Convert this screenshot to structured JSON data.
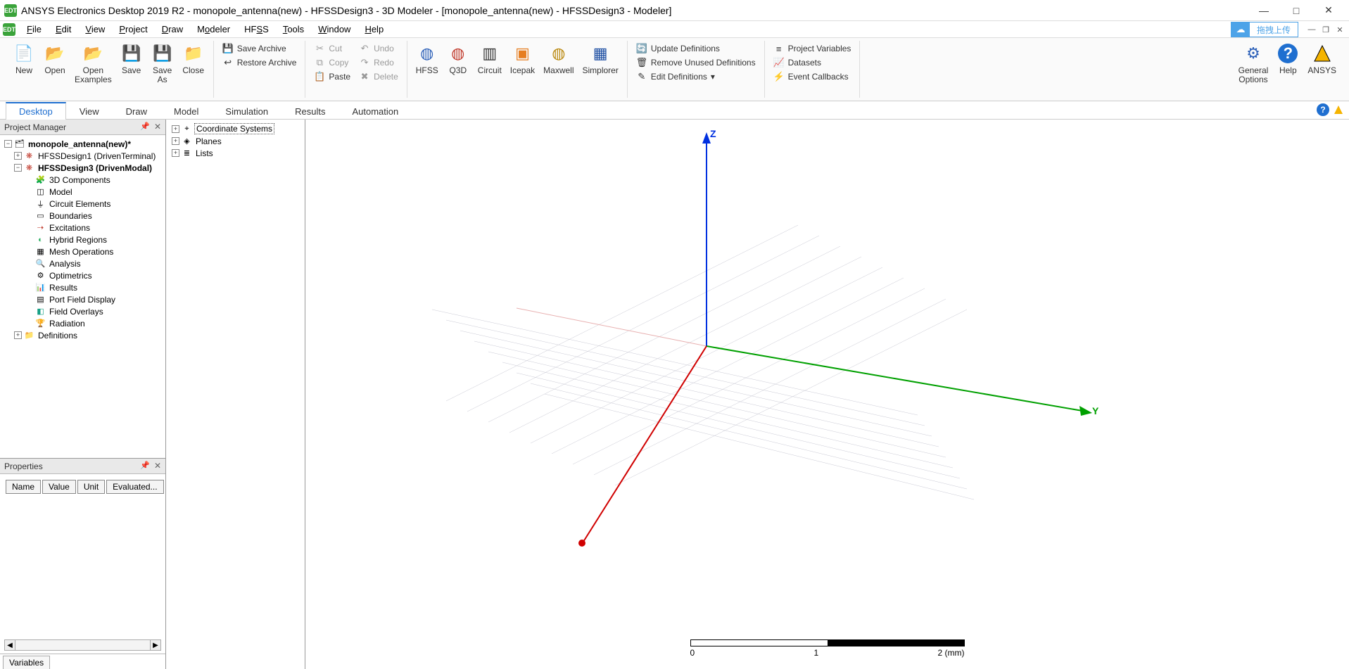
{
  "title": "ANSYS Electronics Desktop 2019 R2 - monopole_antenna(new) - HFSSDesign3 - 3D Modeler - [monopole_antenna(new) - HFSSDesign3 - Modeler]",
  "menus": [
    "File",
    "Edit",
    "View",
    "Project",
    "Draw",
    "Modeler",
    "HFSS",
    "Tools",
    "Window",
    "Help"
  ],
  "upload_label": "拖拽上传",
  "ribbon": {
    "files": {
      "new": "New",
      "open": "Open",
      "open_examples": "Open\nExamples",
      "save": "Save",
      "save_as": "Save\nAs",
      "close": "Close"
    },
    "archive": {
      "save": "Save Archive",
      "restore": "Restore Archive"
    },
    "clip": {
      "cut": "Cut",
      "copy": "Copy",
      "paste": "Paste",
      "undo": "Undo",
      "redo": "Redo",
      "delete": "Delete"
    },
    "sims": {
      "hfss": "HFSS",
      "q3d": "Q3D",
      "circuit": "Circuit",
      "icepak": "Icepak",
      "maxwell": "Maxwell",
      "simplorer": "Simplorer"
    },
    "defs": {
      "update": "Update Definitions",
      "remove": "Remove Unused Definitions",
      "edit": "Edit Definitions"
    },
    "proj": {
      "vars": "Project Variables",
      "datasets": "Datasets",
      "callbacks": "Event Callbacks"
    },
    "right": {
      "general": "General\nOptions",
      "help": "Help",
      "ansys": "ANSYS"
    }
  },
  "tabs": [
    "Desktop",
    "View",
    "Draw",
    "Model",
    "Simulation",
    "Results",
    "Automation"
  ],
  "active_tab": 0,
  "pm_title": "Project Manager",
  "props_title": "Properties",
  "props_cols": [
    "Name",
    "Value",
    "Unit",
    "Evaluated..."
  ],
  "variables_tab": "Variables",
  "project_tree": {
    "root": "monopole_antenna(new)*",
    "designs": [
      {
        "label": "HFSSDesign1 (DrivenTerminal)",
        "bold": false
      },
      {
        "label": "HFSSDesign3 (DrivenModal)",
        "bold": true
      }
    ],
    "children": [
      "3D Components",
      "Model",
      "Circuit Elements",
      "Boundaries",
      "Excitations",
      "Hybrid Regions",
      "Mesh Operations",
      "Analysis",
      "Optimetrics",
      "Results",
      "Port Field Display",
      "Field Overlays",
      "Radiation"
    ],
    "defs": "Definitions"
  },
  "modeler_tree": [
    "Coordinate Systems",
    "Planes",
    "Lists"
  ],
  "axes": {
    "x_near_origin": "",
    "y": "Y",
    "z": "Z"
  },
  "scale": {
    "t0": "0",
    "t1": "1",
    "t2": "2 (mm)"
  }
}
